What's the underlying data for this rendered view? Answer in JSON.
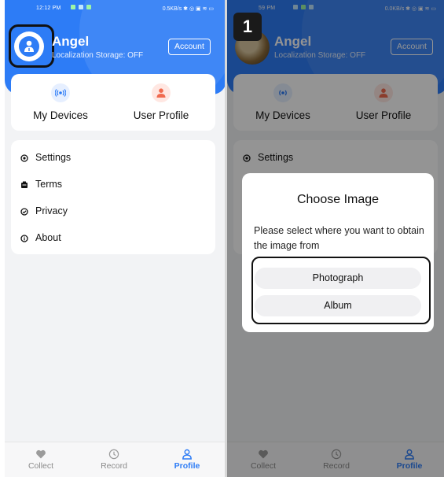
{
  "status": {
    "left_time": "12:12 PM",
    "left_speed": "0.5KB/s",
    "right_time": "59 PM",
    "right_speed": "0.0KB/s"
  },
  "profile": {
    "name": "Angel",
    "storage": "Localization Storage: OFF",
    "account_label": "Account"
  },
  "quick_actions": [
    {
      "label": "My Devices",
      "icon": "broadcast-icon"
    },
    {
      "label": "User Profile",
      "icon": "person-icon"
    }
  ],
  "menu": [
    {
      "label": "Settings",
      "icon": "settings-icon"
    },
    {
      "label": "Terms",
      "icon": "terms-icon"
    },
    {
      "label": "Privacy",
      "icon": "privacy-icon"
    },
    {
      "label": "About",
      "icon": "info-icon"
    }
  ],
  "bottom_nav": [
    {
      "label": "Collect",
      "icon": "heart-icon",
      "active": false
    },
    {
      "label": "Record",
      "icon": "clock-icon",
      "active": false
    },
    {
      "label": "Profile",
      "icon": "user-icon",
      "active": true
    }
  ],
  "step_badge": "1",
  "dialog": {
    "title": "Choose Image",
    "message": "Please select where you want to obtain the image from",
    "options": [
      "Photograph",
      "Album"
    ]
  },
  "colors": {
    "brand": "#2d7cf6",
    "nav_active": "#2d7cf6",
    "profile_icon": "#f06a4f"
  }
}
